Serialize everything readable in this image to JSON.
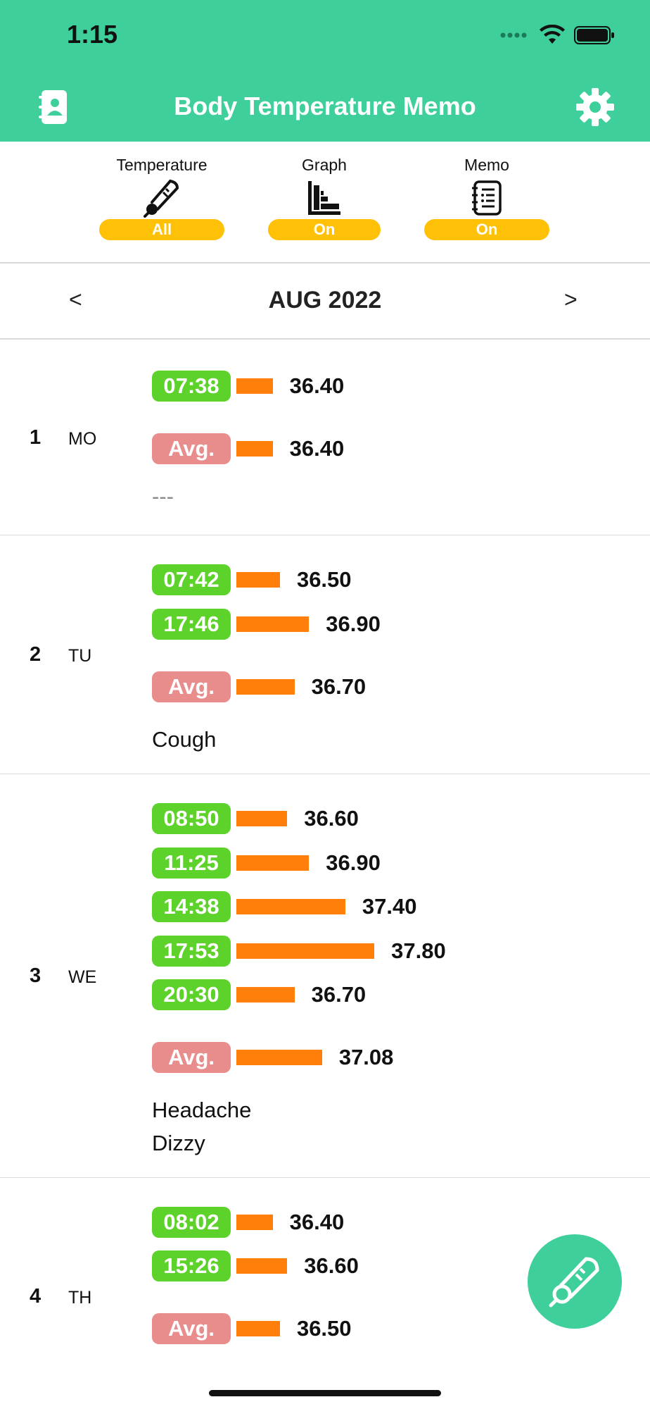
{
  "status_bar": {
    "time": "1:15"
  },
  "header": {
    "title": "Body Temperature Memo",
    "left_icon": "contacts-book-icon",
    "right_icon": "gear-icon"
  },
  "filters": [
    {
      "label": "Temperature",
      "icon": "thermometer-icon",
      "value": "All"
    },
    {
      "label": "Graph",
      "icon": "bar-graph-icon",
      "value": "On"
    },
    {
      "label": "Memo",
      "icon": "notepad-icon",
      "value": "On"
    }
  ],
  "month": {
    "title": "AUG 2022",
    "prev": "<",
    "next": ">"
  },
  "avg_label": "Avg.",
  "bar_scale": {
    "min": 35.9,
    "max": 38.05
  },
  "colors": {
    "accent": "#3ecf9b",
    "time_pill": "#5cd22b",
    "avg_pill": "#e88c8c",
    "bar": "#ff7f0a",
    "filter_pill": "#ffc107"
  },
  "days": [
    {
      "num": "1",
      "weekday": "MO",
      "readings": [
        {
          "time": "07:38",
          "temp": "36.40"
        }
      ],
      "avg": "36.40",
      "memo": [
        "---"
      ]
    },
    {
      "num": "2",
      "weekday": "TU",
      "readings": [
        {
          "time": "07:42",
          "temp": "36.50"
        },
        {
          "time": "17:46",
          "temp": "36.90"
        }
      ],
      "avg": "36.70",
      "memo": [
        "Cough"
      ]
    },
    {
      "num": "3",
      "weekday": "WE",
      "readings": [
        {
          "time": "08:50",
          "temp": "36.60"
        },
        {
          "time": "11:25",
          "temp": "36.90"
        },
        {
          "time": "14:38",
          "temp": "37.40"
        },
        {
          "time": "17:53",
          "temp": "37.80"
        },
        {
          "time": "20:30",
          "temp": "36.70"
        }
      ],
      "avg": "37.08",
      "memo": [
        "Headache",
        "Dizzy"
      ]
    },
    {
      "num": "4",
      "weekday": "TH",
      "readings": [
        {
          "time": "08:02",
          "temp": "36.40"
        },
        {
          "time": "15:26",
          "temp": "36.60"
        }
      ],
      "avg": "36.50",
      "memo": []
    }
  ],
  "fab_icon": "thermometer-pen-icon"
}
